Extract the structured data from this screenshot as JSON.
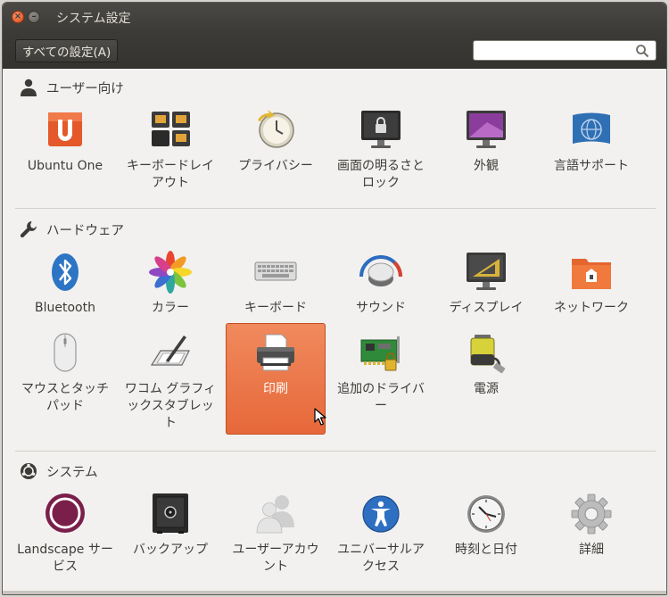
{
  "window": {
    "title": "システム設定"
  },
  "toolbar": {
    "all_settings_label": "すべての設定(A)",
    "search_value": ""
  },
  "sections": [
    {
      "name": "ユーザー向け",
      "icon": "person-icon",
      "items": [
        {
          "label": "Ubuntu One",
          "icon": "ubuntu-one-icon"
        },
        {
          "label": "キーボードレイアウト",
          "icon": "keyboard-layout-icon"
        },
        {
          "label": "プライバシー",
          "icon": "privacy-icon"
        },
        {
          "label": "画面の明るさとロック",
          "icon": "screen-lock-icon"
        },
        {
          "label": "外観",
          "icon": "appearance-icon"
        },
        {
          "label": "言語サポート",
          "icon": "language-support-icon"
        }
      ]
    },
    {
      "name": "ハードウェア",
      "icon": "wrench-icon",
      "items": [
        {
          "label": "Bluetooth",
          "icon": "bluetooth-icon"
        },
        {
          "label": "カラー",
          "icon": "color-icon"
        },
        {
          "label": "キーボード",
          "icon": "keyboard-icon"
        },
        {
          "label": "サウンド",
          "icon": "sound-icon"
        },
        {
          "label": "ディスプレイ",
          "icon": "display-icon"
        },
        {
          "label": "ネットワーク",
          "icon": "network-icon"
        },
        {
          "label": "マウスとタッチパッド",
          "icon": "mouse-icon"
        },
        {
          "label": "ワコム グラフィックスタブレット",
          "icon": "wacom-tablet-icon"
        },
        {
          "label": "印刷",
          "icon": "printer-icon",
          "selected": true
        },
        {
          "label": "追加のドライバー",
          "icon": "additional-drivers-icon"
        },
        {
          "label": "電源",
          "icon": "power-icon"
        }
      ]
    },
    {
      "name": "システム",
      "icon": "system-icon",
      "items": [
        {
          "label": "Landscape サービス",
          "icon": "landscape-icon"
        },
        {
          "label": "バックアップ",
          "icon": "backup-icon"
        },
        {
          "label": "ユーザーアカウント",
          "icon": "user-accounts-icon"
        },
        {
          "label": "ユニバーサルアクセス",
          "icon": "universal-access-icon"
        },
        {
          "label": "時刻と日付",
          "icon": "clock-icon"
        },
        {
          "label": "詳細",
          "icon": "details-gear-icon"
        }
      ]
    }
  ],
  "colors": {
    "accent": "#e9713f",
    "titlebar": "#3c3b37",
    "background": "#f2f1f0"
  }
}
